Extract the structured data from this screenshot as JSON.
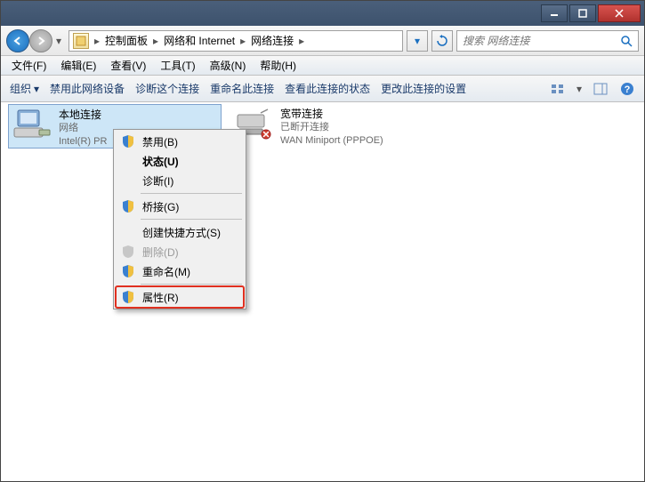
{
  "titlebar": {
    "title": ""
  },
  "breadcrumbs": {
    "b0": "控制面板",
    "b1": "网络和 Internet",
    "b2": "网络连接"
  },
  "search": {
    "placeholder": "搜索 网络连接"
  },
  "menubar": {
    "m0": "文件(F)",
    "m1": "编辑(E)",
    "m2": "查看(V)",
    "m3": "工具(T)",
    "m4": "高级(N)",
    "m5": "帮助(H)"
  },
  "toolbar": {
    "t0": "组织",
    "t1": "禁用此网络设备",
    "t2": "诊断这个连接",
    "t3": "重命名此连接",
    "t4": "查看此连接的状态",
    "t5": "更改此连接的设置"
  },
  "connections": {
    "c0": {
      "title": "本地连接",
      "status": "网络",
      "device": "Intel(R) PR"
    },
    "c1": {
      "title": "宽带连接",
      "status": "已断开连接",
      "device": "WAN Miniport (PPPOE)"
    }
  },
  "contextmenu": {
    "i0": "禁用(B)",
    "i1": "状态(U)",
    "i2": "诊断(I)",
    "i3": "桥接(G)",
    "i4": "创建快捷方式(S)",
    "i5": "删除(D)",
    "i6": "重命名(M)",
    "i7": "属性(R)"
  }
}
